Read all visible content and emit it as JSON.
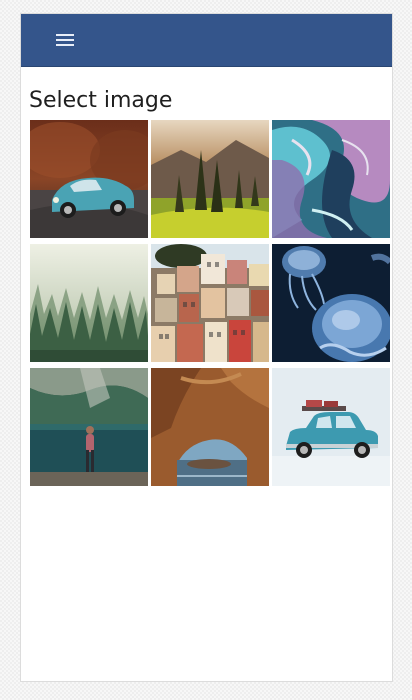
{
  "header": {
    "menu_icon": "hamburger-menu-icon",
    "bar_color": "#34558b"
  },
  "main": {
    "title": "Select image"
  },
  "images": [
    {
      "subject": "classic-car-on-road"
    },
    {
      "subject": "mountain-forest-sunset"
    },
    {
      "subject": "marbled-abstract-paint"
    },
    {
      "subject": "misty-pine-forest"
    },
    {
      "subject": "colorful-cliff-village"
    },
    {
      "subject": "jellyfish"
    },
    {
      "subject": "woman-by-mountain-lake"
    },
    {
      "subject": "sea-rock-arch"
    },
    {
      "subject": "blue-car-with-roof-rack"
    }
  ]
}
